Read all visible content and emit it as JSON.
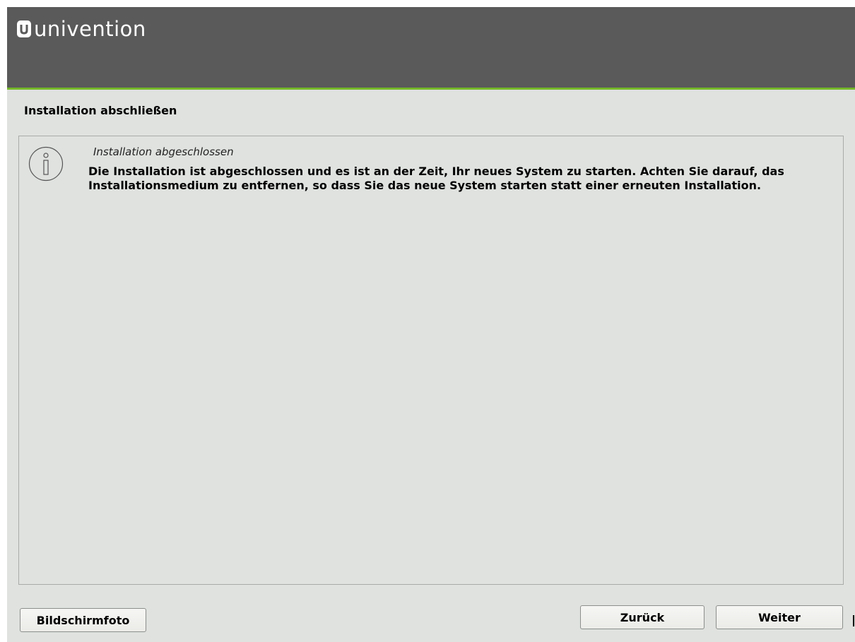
{
  "header": {
    "brand": "univention",
    "logo_icon": "univention-logo-icon",
    "background_color": "#5a5a5a",
    "accent_color": "#76b82a"
  },
  "page": {
    "title": "Installation abschließen"
  },
  "message": {
    "icon": "info-icon",
    "heading": "Installation abgeschlossen",
    "body": "Die Installation ist abgeschlossen und es ist an der Zeit, Ihr neues System zu starten. Achten Sie darauf, das Installationsmedium zu entfernen, so dass Sie das neue System starten statt einer erneuten Installation."
  },
  "footer": {
    "screenshot_label": "Bildschirmfoto",
    "back_label": "Zurück",
    "next_label": "Weiter"
  }
}
